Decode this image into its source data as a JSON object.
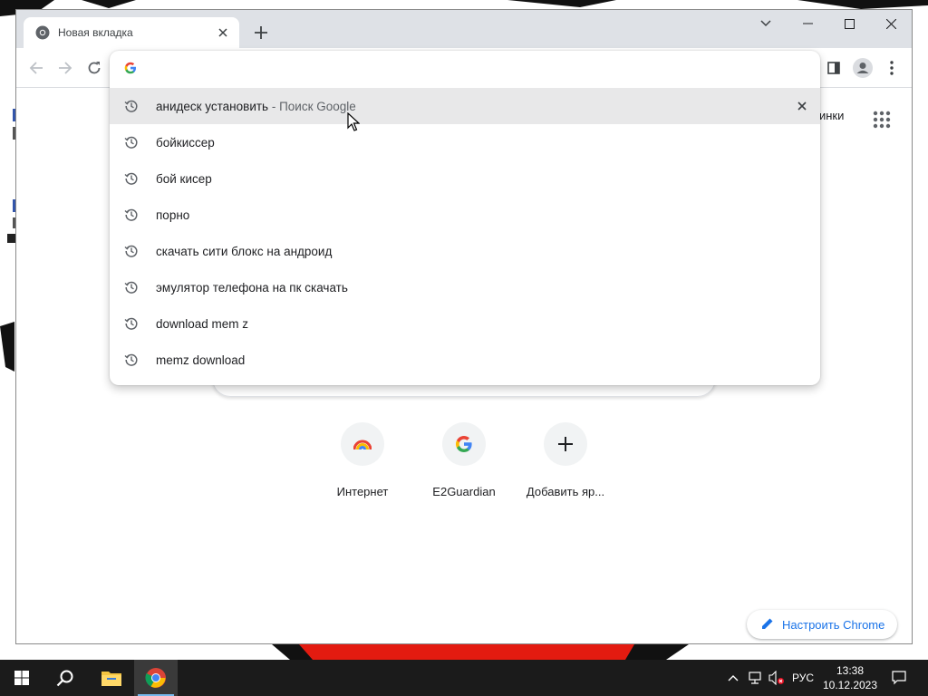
{
  "browser": {
    "tab": {
      "title": "Новая вкладка"
    },
    "omnibox": {
      "value": "",
      "suggestions": [
        {
          "text": "анидеск установить",
          "suffix": " - Поиск Google",
          "selected": true
        },
        {
          "text": "бойкиссер"
        },
        {
          "text": "бой кисер"
        },
        {
          "text": "порно"
        },
        {
          "text": "скачать сити блокс на андроид"
        },
        {
          "text": "эмулятор телефона на пк скачать"
        },
        {
          "text": "download mem z"
        },
        {
          "text": "memz download"
        }
      ]
    }
  },
  "new_tab_page": {
    "images_link": "тинки",
    "shortcuts": [
      {
        "label": "Интернет",
        "icon": "rainbow-icon"
      },
      {
        "label": "E2Guardian",
        "icon": "google-g-icon"
      },
      {
        "label": "Добавить яр...",
        "icon": "plus-icon"
      }
    ],
    "customize_button": "Настроить Chrome"
  },
  "taskbar": {
    "language": "РУС",
    "time": "13:38",
    "date": "10.12.2023"
  },
  "colors": {
    "accent": "#1a73e8",
    "tabstrip": "#dee1e6",
    "taskbar": "#1b1b1b",
    "desktop_red": "#e31b10"
  }
}
